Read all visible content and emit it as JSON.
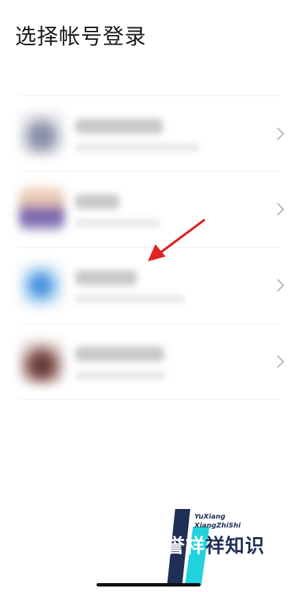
{
  "header": {
    "title": "选择帐号登录"
  },
  "accounts": [
    {
      "name": "",
      "subtitle": ""
    },
    {
      "name": "",
      "subtitle": ""
    },
    {
      "name": "",
      "subtitle": ""
    },
    {
      "name": "",
      "subtitle": ""
    }
  ],
  "watermark": {
    "line1": "YuXiang",
    "line2": "XiangZhiShi",
    "brand_part1": "誉",
    "brand_part2": "祥",
    "brand_part3": "祥知识"
  },
  "icons": {
    "row_chevron": "chevron-right-icon",
    "annotation": "red-arrow-icon"
  },
  "colors": {
    "annotation_arrow": "#e02424",
    "watermark_navy": "#1f2f56",
    "watermark_cyan": "#22d3dd"
  }
}
